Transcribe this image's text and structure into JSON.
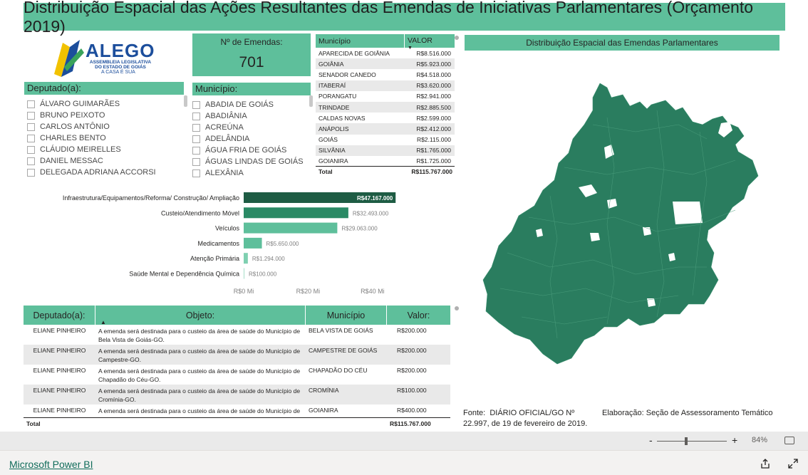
{
  "report_title": "Distribuição Espacial das Ações Resultantes das Emendas de Iniciativas Parlamentares (Orçamento 2019)",
  "logo": {
    "name": "ALEGO",
    "subtitle": "ASSEMBLEIA LEGISLATIVA DO ESTADO DE GOIÁS",
    "tagline": "A CASA É SUA"
  },
  "kpi": {
    "label": "Nº de Emendas:",
    "value": "701"
  },
  "deputado_slicer": {
    "title": "Deputado(a):",
    "items": [
      "ÁLVARO GUIMARÃES",
      "BRUNO PEIXOTO",
      "CARLOS ANTÔNIO",
      "CHARLES BENTO",
      "CLÁUDIO MEIRELLES",
      "DANIEL MESSAC",
      "DELEGADA ADRIANA ACCORSI"
    ]
  },
  "municipio_slicer": {
    "title": "Município:",
    "items": [
      "ABADIA DE GOIÁS",
      "ABADIÂNIA",
      "ACREÚNA",
      "ADELÂNDIA",
      "ÁGUA FRIA DE GOIÁS",
      "ÁGUAS LINDAS DE GOIÁS",
      "ALEXÂNIA"
    ]
  },
  "municipio_table": {
    "headers": {
      "municipio": "Município",
      "valor": "VALOR"
    },
    "rows": [
      {
        "municipio": "APARECIDA DE GOIÂNIA",
        "valor": "R$8.516.000"
      },
      {
        "municipio": "GOIÂNIA",
        "valor": "R$5.923.000"
      },
      {
        "municipio": "SENADOR CANEDO",
        "valor": "R$4.518.000"
      },
      {
        "municipio": "ITABERAÍ",
        "valor": "R$3.620.000"
      },
      {
        "municipio": "PORANGATU",
        "valor": "R$2.941.000"
      },
      {
        "municipio": "TRINDADE",
        "valor": "R$2.885.500"
      },
      {
        "municipio": "CALDAS NOVAS",
        "valor": "R$2.599.000"
      },
      {
        "municipio": "ANÁPOLIS",
        "valor": "R$2.412.000"
      },
      {
        "municipio": "GOIÁS",
        "valor": "R$2.115.000"
      },
      {
        "municipio": "SILVÂNIA",
        "valor": "R$1.765.000"
      },
      {
        "municipio": "GOIANIRA",
        "valor": "R$1.725.000"
      }
    ],
    "total_label": "Total",
    "total_value": "R$115.767.000"
  },
  "chart_data": {
    "type": "bar",
    "orientation": "horizontal",
    "categories": [
      "Infraestrutura/Equipamentos/Reforma/ Construção/ Ampliação",
      "Custeio/Atendimento Móvel",
      "Veículos",
      "Medicamentos",
      "Atenção Primária",
      "Saúde Mental e Dependência Química"
    ],
    "values": [
      47167000,
      32493000,
      29063000,
      5650000,
      1294000,
      100000
    ],
    "data_labels": [
      "R$47.167.000",
      "R$32.493.000",
      "R$29.063.000",
      "R$5.650.000",
      "R$1.294.000",
      "R$100.000"
    ],
    "bar_colors": [
      "#1e5c44",
      "#2a8a65",
      "#5ebf9b",
      "#5ebf9b",
      "#7fd0b1",
      "#a6dfc9"
    ],
    "xlim": [
      0,
      48000000
    ],
    "x_ticks": [
      0,
      20000000,
      40000000
    ],
    "x_tick_labels": [
      "R$0 Mi",
      "R$20 Mi",
      "R$40 Mi"
    ],
    "grid": false
  },
  "detail_table": {
    "headers": {
      "deputado": "Deputado(a):",
      "objeto": "Objeto:",
      "municipio": "Município",
      "valor": "Valor:"
    },
    "rows": [
      {
        "deputado": "ELIANE PINHEIRO",
        "objeto": "A emenda será destinada para o custeio da área de saúde do Município de Bela Vista de Goiás-GO.",
        "municipio": "BELA VISTA DE GOIÁS",
        "valor": "R$200.000"
      },
      {
        "deputado": "ELIANE PINHEIRO",
        "objeto": "A emenda será destinada para o custeio da área de saúde do Município de Campestre-GO.",
        "municipio": "CAMPESTRE DE GOIÁS",
        "valor": "R$200.000"
      },
      {
        "deputado": "ELIANE PINHEIRO",
        "objeto": "A emenda será destinada para o custeio da área de saúde do Município de Chapadão do Céu-GO.",
        "municipio": "CHAPADÃO DO CÉU",
        "valor": "R$200.000"
      },
      {
        "deputado": "ELIANE PINHEIRO",
        "objeto": "A emenda será destinada para o custeio da área de saúde do Município de Cromínia-GO.",
        "municipio": "CROMÍNIA",
        "valor": "R$100.000"
      },
      {
        "deputado": "ELIANE PINHEIRO",
        "objeto": "A emenda será destinada para o custeio da área de saúde do Município de Goianira-GO.",
        "municipio": "GOIANIRA",
        "valor": "R$400.000"
      }
    ],
    "total_label": "Total",
    "total_value": "R$115.767.000"
  },
  "map": {
    "title": "Distribuição Espacial das Emendas Parlamentares",
    "fill_color": "#2a7d5f"
  },
  "source_note": {
    "label": "Fonte:",
    "text": "DIÁRIO OFICIAL/GO Nº 22.997, de 19 de fevereiro de 2019."
  },
  "elaboration_note": {
    "label": "Elaboração:",
    "text": "Seção de Assessoramento Temático"
  },
  "zoom": {
    "minus": "-",
    "plus": "+",
    "level": "84%"
  },
  "footer": {
    "brand": "Microsoft Power BI"
  },
  "colors": {
    "accent": "#5ebf9b",
    "dark_accent": "#1e5c44",
    "map_fill": "#2a7d5f"
  }
}
